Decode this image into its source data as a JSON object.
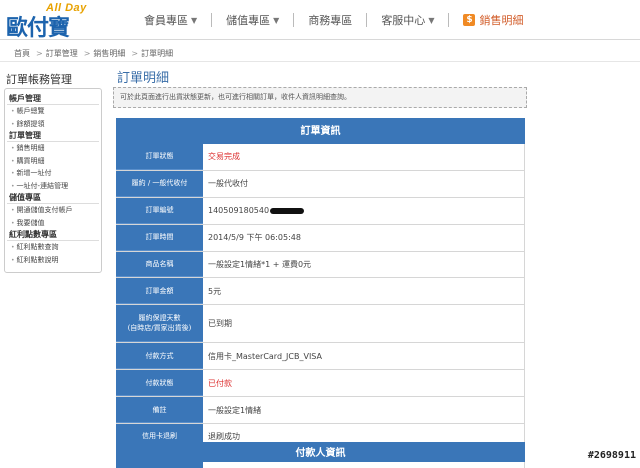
{
  "header": {
    "logo_tag": "All Day",
    "logo_brand": "歐付寶",
    "nav": [
      {
        "label": "會員專區",
        "chevron": true
      },
      {
        "label": "儲值專區",
        "chevron": true
      },
      {
        "label": "商務專區",
        "chevron": false
      },
      {
        "label": "客服中心",
        "chevron": true
      }
    ],
    "sale_icon": "$",
    "sale_label": "銷售明細"
  },
  "breadcrumb": [
    "首頁",
    "訂單管理",
    "銷售明細",
    "訂單明細"
  ],
  "sidebar": {
    "title": "訂單帳務管理",
    "groups": [
      {
        "label": "帳戶管理",
        "items": [
          "帳戶總覽",
          "餘額提領"
        ]
      },
      {
        "label": "訂單管理",
        "items": [
          "銷售明細",
          "購買明細",
          "新增一址付",
          "一址付-連結管理"
        ]
      },
      {
        "label": "儲值專區",
        "items": [
          "開通儲值支付帳戶",
          "我要儲值"
        ]
      },
      {
        "label": "紅利點數專區",
        "items": [
          "紅利點數查詢",
          "紅利點數說明"
        ]
      }
    ]
  },
  "main": {
    "title": "訂單明細",
    "notice": "可於此頁面進行出貨狀態更新，也可進行相關訂單，收件人資訊明細查詢。",
    "order_header": "訂單資訊",
    "rows": [
      {
        "label": "訂單狀態",
        "value": "交易完成",
        "red": true
      },
      {
        "label": "履約 / 一般代收付",
        "value": "一般代收付",
        "red": false
      },
      {
        "label": "訂單編號",
        "value": "140509180540",
        "red": false,
        "redacted": true
      },
      {
        "label": "訂單時間",
        "value": "2014/5/9 下午 06:05:48",
        "red": false
      },
      {
        "label": "商品名稱",
        "value": "一般設定1情緒*1 + 運費0元",
        "red": false
      },
      {
        "label": "訂單金額",
        "value": "5元",
        "red": false
      },
      {
        "label": "履約保證天數\n(自時店/買家出貨後)",
        "value": "已到期",
        "red": false,
        "tall": true
      },
      {
        "label": "付款方式",
        "value": "信用卡_MasterCard_JCB_VISA",
        "red": false
      },
      {
        "label": "付款狀態",
        "value": "已付款",
        "red": true
      },
      {
        "label": "備註",
        "value": "一般設定1情緒",
        "red": false
      },
      {
        "label": "信用卡退刷",
        "value": "退刷成功",
        "red": false
      }
    ],
    "payer_header": "付款人資訊"
  },
  "watermark": "#2698911",
  "colors": {
    "table_blue": "#3a76b8",
    "title_blue": "#3a6ea8",
    "status_red": "#dd3333",
    "sale_orange": "#f08a24"
  }
}
